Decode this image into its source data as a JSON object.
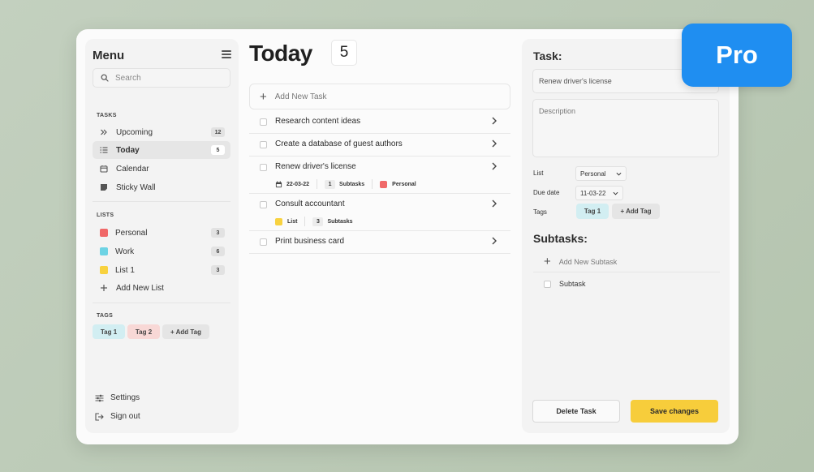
{
  "sidebar": {
    "title": "Menu",
    "search_placeholder": "Search",
    "tasks_label": "TASKS",
    "tasks": [
      {
        "label": "Upcoming",
        "count": "12",
        "icon": "double-chevron-icon"
      },
      {
        "label": "Today",
        "count": "5",
        "icon": "checklist-icon",
        "active": true
      },
      {
        "label": "Calendar",
        "icon": "calendar-icon"
      },
      {
        "label": "Sticky Wall",
        "icon": "sticky-note-icon"
      }
    ],
    "lists_label": "LISTS",
    "lists": [
      {
        "label": "Personal",
        "count": "3",
        "color": "#f06868"
      },
      {
        "label": "Work",
        "count": "6",
        "color": "#6dd3e4"
      },
      {
        "label": "List 1",
        "count": "3",
        "color": "#f8d23f"
      }
    ],
    "add_list_label": "Add New List",
    "tags_label": "TAGS",
    "tags": [
      {
        "label": "Tag 1",
        "color": "#d2eef2"
      },
      {
        "label": "Tag 2",
        "color": "#f8d8d6"
      }
    ],
    "add_tag_label": "+ Add Tag",
    "settings_label": "Settings",
    "signout_label": "Sign out"
  },
  "main": {
    "title": "Today",
    "count": "5",
    "add_task_label": "Add New Task",
    "tasks": [
      {
        "name": "Research content ideas"
      },
      {
        "name": "Create a database of guest authors"
      },
      {
        "name": "Renew driver's license",
        "date": "22-03-22",
        "subtask_count": "1",
        "subtask_label": "Subtasks",
        "list": "Personal",
        "list_color": "#f06868"
      },
      {
        "name": "Consult accountant",
        "list": "List",
        "list_color": "#f8d23f",
        "subtask_count": "3",
        "subtask_label": "Subtasks"
      },
      {
        "name": "Print business card"
      }
    ]
  },
  "detail": {
    "title": "Task:",
    "name_value": "Renew driver's license",
    "description_placeholder": "Description",
    "list_label": "List",
    "list_value": "Personal",
    "due_label": "Due date",
    "due_value": "11-03-22",
    "tags_label": "Tags",
    "tag_value": "Tag 1",
    "add_tag_label": "+ Add Tag",
    "subtasks_title": "Subtasks:",
    "add_subtask_label": "Add New Subtask",
    "subtasks": [
      {
        "label": "Subtask"
      }
    ],
    "delete_label": "Delete Task",
    "save_label": "Save changes"
  },
  "badge": {
    "label": "Pro",
    "color": "#1f8ef1"
  },
  "colors": {
    "accent_yellow": "#f7cd3b",
    "background": "#b9c8b4"
  }
}
